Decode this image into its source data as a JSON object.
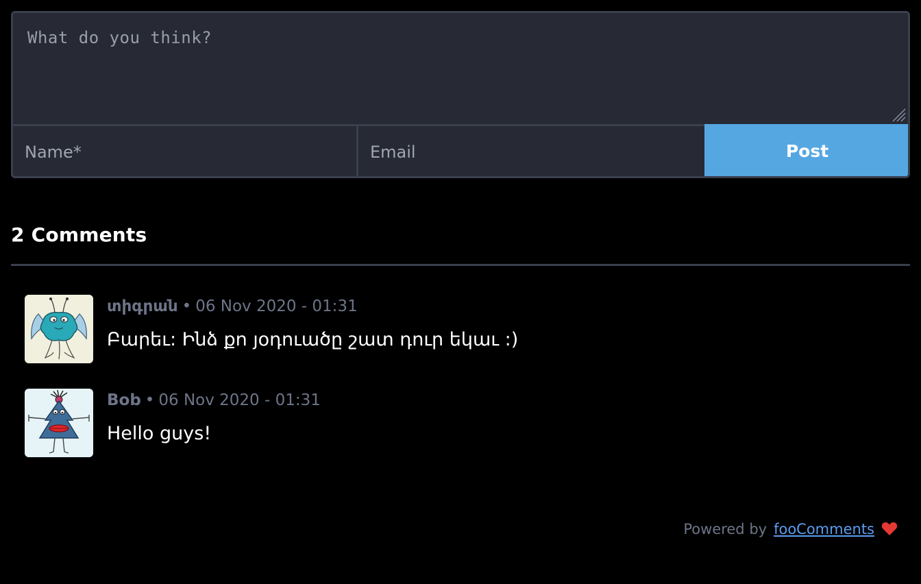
{
  "form": {
    "textarea_placeholder": "What do you think?",
    "name_placeholder": "Name*",
    "email_placeholder": "Email",
    "post_label": "Post"
  },
  "comments_header": "2 Comments",
  "comments": [
    {
      "author": "տիգրան",
      "date": "06 Nov 2020 - 01:31",
      "text": "Բարեւ: Ինձ քո յօդուածը շատ դուր եկաւ :)",
      "avatar_icon": "alien-face-avatar-icon"
    },
    {
      "author": "Bob",
      "date": "06 Nov 2020 - 01:31",
      "text": "Hello guys!",
      "avatar_icon": "tree-creature-avatar-icon"
    }
  ],
  "footer": {
    "powered_by": "Powered by",
    "link_text": "fooComments",
    "heart_icon": "heart-icon"
  },
  "colors": {
    "background": "#000000",
    "form_bg": "#272a35",
    "border": "#3a3f4e",
    "accent": "#55a7e2",
    "muted": "#6e7589",
    "link": "#5b9cf0",
    "heart": "#e53935"
  }
}
